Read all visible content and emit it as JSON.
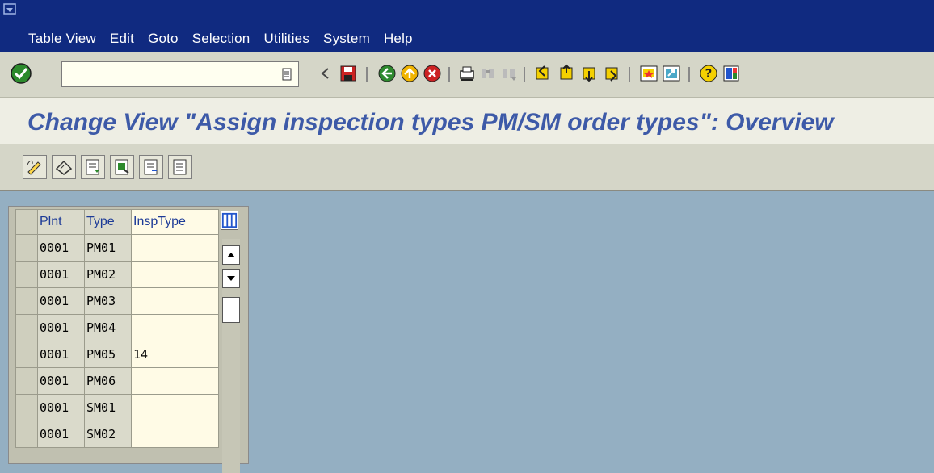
{
  "menu": {
    "items": [
      {
        "label": "Table View",
        "ul": "T"
      },
      {
        "label": "Edit",
        "ul": "E"
      },
      {
        "label": "Goto",
        "ul": "G"
      },
      {
        "label": "Selection",
        "ul": "S"
      },
      {
        "label": "Utilities",
        "ul": ""
      },
      {
        "label": "System",
        "ul": ""
      },
      {
        "label": "Help",
        "ul": "H"
      }
    ]
  },
  "toolbar": {
    "command_value": "",
    "icons": [
      "enter-check-icon",
      "dropdown-icon",
      "back-arrow-icon",
      "save-icon",
      "back-icon",
      "exit-icon",
      "cancel-icon",
      "print-icon",
      "find-icon",
      "find-next-icon",
      "first-page-icon",
      "prev-page-icon",
      "next-page-icon",
      "last-page-icon",
      "new-session-icon",
      "shortcut-icon",
      "help-icon",
      "layout-icon"
    ]
  },
  "page": {
    "title": "Change View \"Assign inspection types PM/SM order types\": Overview"
  },
  "table": {
    "headers": [
      "Plnt",
      "Type",
      "InspType"
    ],
    "rows": [
      {
        "plnt": "0001",
        "type": "PM01",
        "insp": ""
      },
      {
        "plnt": "0001",
        "type": "PM02",
        "insp": ""
      },
      {
        "plnt": "0001",
        "type": "PM03",
        "insp": ""
      },
      {
        "plnt": "0001",
        "type": "PM04",
        "insp": ""
      },
      {
        "plnt": "0001",
        "type": "PM05",
        "insp": "14"
      },
      {
        "plnt": "0001",
        "type": "PM06",
        "insp": ""
      },
      {
        "plnt": "0001",
        "type": "SM01",
        "insp": ""
      },
      {
        "plnt": "0001",
        "type": "SM02",
        "insp": ""
      }
    ]
  },
  "colors": {
    "menubar": "#102a80",
    "toolbar": "#d5d6c8",
    "title": "#3d5aa8",
    "background": "#94afc2"
  }
}
